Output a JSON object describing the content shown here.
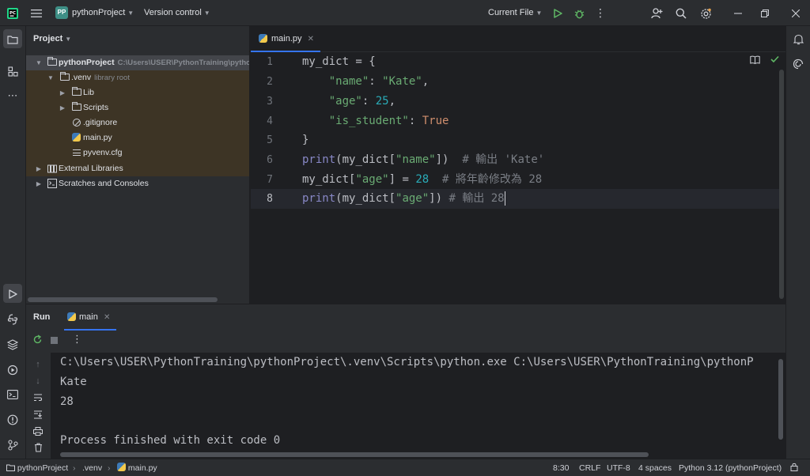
{
  "titlebar": {
    "badge": "PP",
    "project_name": "pythonProject",
    "version_control": "Version control",
    "run_config": "Current File"
  },
  "project_panel": {
    "title": "Project",
    "tree": [
      {
        "label": "pythonProject",
        "hint": "C:\\Users\\USER\\PythonTraining\\pytho"
      },
      {
        "label": ".venv",
        "hint": "library root"
      },
      {
        "label": "Lib"
      },
      {
        "label": "Scripts"
      },
      {
        "label": ".gitignore"
      },
      {
        "label": "main.py"
      },
      {
        "label": "pyvenv.cfg"
      },
      {
        "label": "External Libraries"
      },
      {
        "label": "Scratches and Consoles"
      }
    ]
  },
  "editor": {
    "tab": "main.py",
    "line_numbers": [
      "1",
      "2",
      "3",
      "4",
      "5",
      "6",
      "7",
      "8"
    ]
  },
  "code": {
    "l1": "my_dict = {",
    "l2_key": "\"name\"",
    "l2_sep": ": ",
    "l2_val": "\"Kate\"",
    "l2_end": ",",
    "l3_key": "\"age\"",
    "l3_sep": ": ",
    "l3_val": "25",
    "l3_end": ",",
    "l4_key": "\"is_student\"",
    "l4_sep": ": ",
    "l4_val": "True",
    "l5": "}",
    "l6_fn": "print",
    "l6_a": "(my_dict[",
    "l6_key": "\"name\"",
    "l6_b": "])  ",
    "l6_cmt": "# 輸出 'Kate'",
    "l7_a": "my_dict[",
    "l7_key": "\"age\"",
    "l7_b": "] = ",
    "l7_val": "28",
    "l7_sp": "  ",
    "l7_cmt": "# 將年齡修改為 28",
    "l8_fn": "print",
    "l8_a": "(my_dict[",
    "l8_key": "\"age\"",
    "l8_b": "]) ",
    "l8_cmt": "# 輸出 28"
  },
  "run_panel": {
    "title": "Run",
    "tab": "main",
    "output": [
      "C:\\Users\\USER\\PythonTraining\\pythonProject\\.venv\\Scripts\\python.exe C:\\Users\\USER\\PythonTraining\\pythonP",
      "Kate",
      "28",
      "",
      "Process finished with exit code 0"
    ]
  },
  "status": {
    "crumbs": [
      "pythonProject",
      ".venv",
      "main.py"
    ],
    "position": "8:30",
    "line_sep": "CRLF",
    "encoding": "UTF-8",
    "indent": "4 spaces",
    "interpreter": "Python 3.12 (pythonProject)"
  },
  "colors": {
    "accent": "#3574f0",
    "run_green": "#5fb865",
    "string": "#6aab73",
    "number": "#2aacb8",
    "keyword": "#cf8e6d"
  }
}
